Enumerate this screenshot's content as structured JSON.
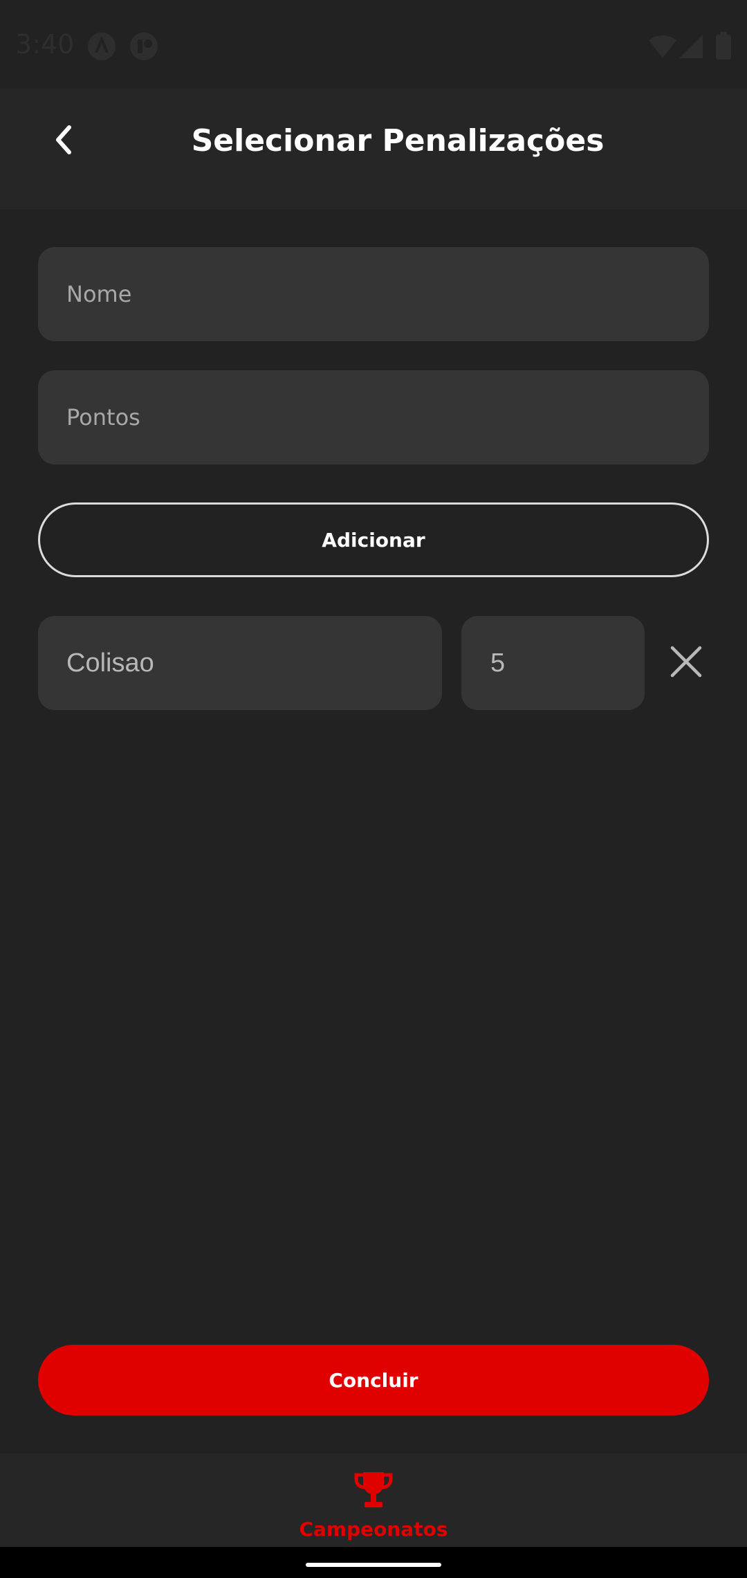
{
  "status_bar": {
    "time": "3:40",
    "icons": [
      "notification-a-icon",
      "notification-app-icon",
      "wifi-icon",
      "signal-icon",
      "battery-icon"
    ]
  },
  "header": {
    "title": "Selecionar Penalizações",
    "back_icon": "chevron-left-icon"
  },
  "form": {
    "name_placeholder": "Nome",
    "name_value": "",
    "points_placeholder": "Pontos",
    "points_value": "",
    "add_label": "Adicionar"
  },
  "penalties": [
    {
      "name": "Colisao",
      "points": "5",
      "remove_icon": "close-icon"
    }
  ],
  "actions": {
    "done_label": "Concluir"
  },
  "bottom_nav": {
    "items": [
      {
        "label": "Campeonatos",
        "icon": "trophy-icon",
        "active": true
      }
    ]
  },
  "colors": {
    "background": "#222222",
    "header": "#262626",
    "field": "#353535",
    "accent": "#e00000",
    "text": "#ffffff"
  }
}
